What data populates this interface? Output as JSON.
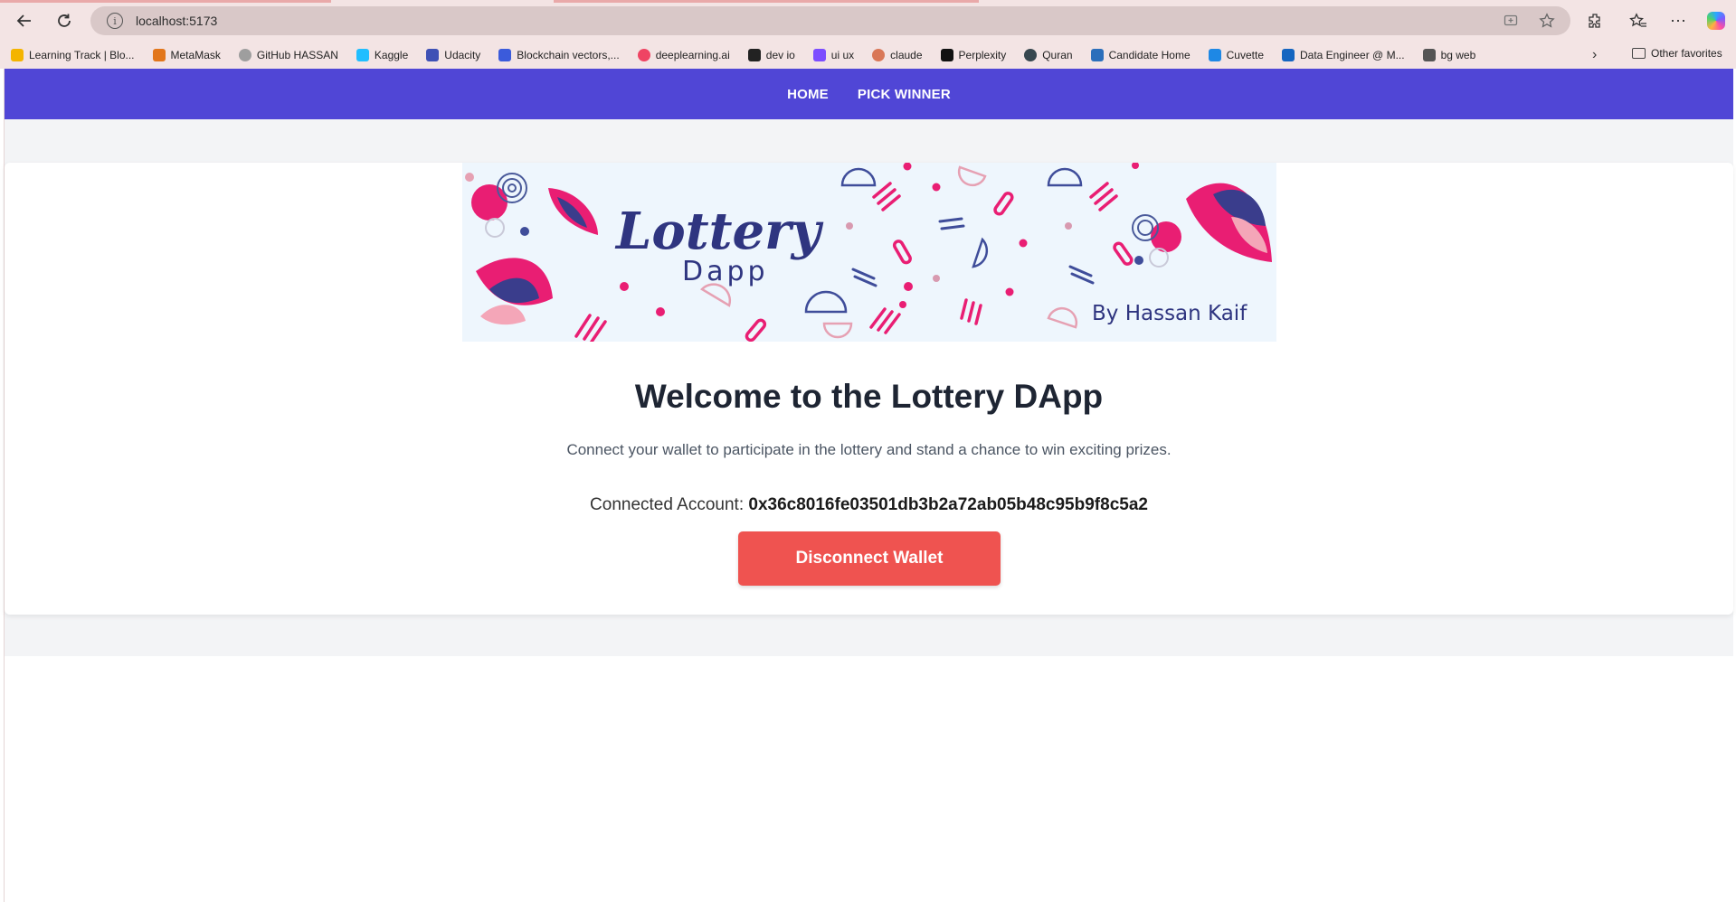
{
  "browser": {
    "url": "localhost:5173",
    "bookmarks": [
      {
        "label": "Learning Track | Blo...",
        "color": "#f4b400"
      },
      {
        "label": "MetaMask",
        "color": "#e2761b"
      },
      {
        "label": "GitHub HASSAN",
        "color": "#9e9e9e"
      },
      {
        "label": "Kaggle",
        "color": "#20beff"
      },
      {
        "label": "Udacity",
        "color": "#3f51b5"
      },
      {
        "label": "Blockchain vectors,...",
        "color": "#3b5bdb"
      },
      {
        "label": "deeplearning.ai",
        "color": "#ef4463"
      },
      {
        "label": "dev io",
        "color": "#222222"
      },
      {
        "label": "ui ux",
        "color": "#7c4dff"
      },
      {
        "label": "claude",
        "color": "#d97757"
      },
      {
        "label": "Perplexity",
        "color": "#111111"
      },
      {
        "label": "Quran",
        "color": "#37474f"
      },
      {
        "label": "Candidate Home",
        "color": "#2c6fbb"
      },
      {
        "label": "Cuvette",
        "color": "#1e88e5"
      },
      {
        "label": "Data Engineer @ M...",
        "color": "#1565c0"
      },
      {
        "label": "bg web",
        "color": "#555555"
      }
    ],
    "other_favorites": "Other favorites"
  },
  "nav": {
    "home": "HOME",
    "pick_winner": "PICK WINNER",
    "bg_color": "#5046d6"
  },
  "banner": {
    "title": "Lottery",
    "subtitle": "Dapp",
    "byline": "By Hassan Kaif"
  },
  "main": {
    "heading": "Welcome to the Lottery DApp",
    "description": "Connect your wallet to participate in the lottery and stand a chance to win exciting prizes.",
    "account_label": "Connected Account:",
    "account_address": "0x36c8016fe03501db3b2a72ab05b48c95b9f8c5a2",
    "disconnect_label": "Disconnect Wallet",
    "button_color": "#ef5350"
  }
}
